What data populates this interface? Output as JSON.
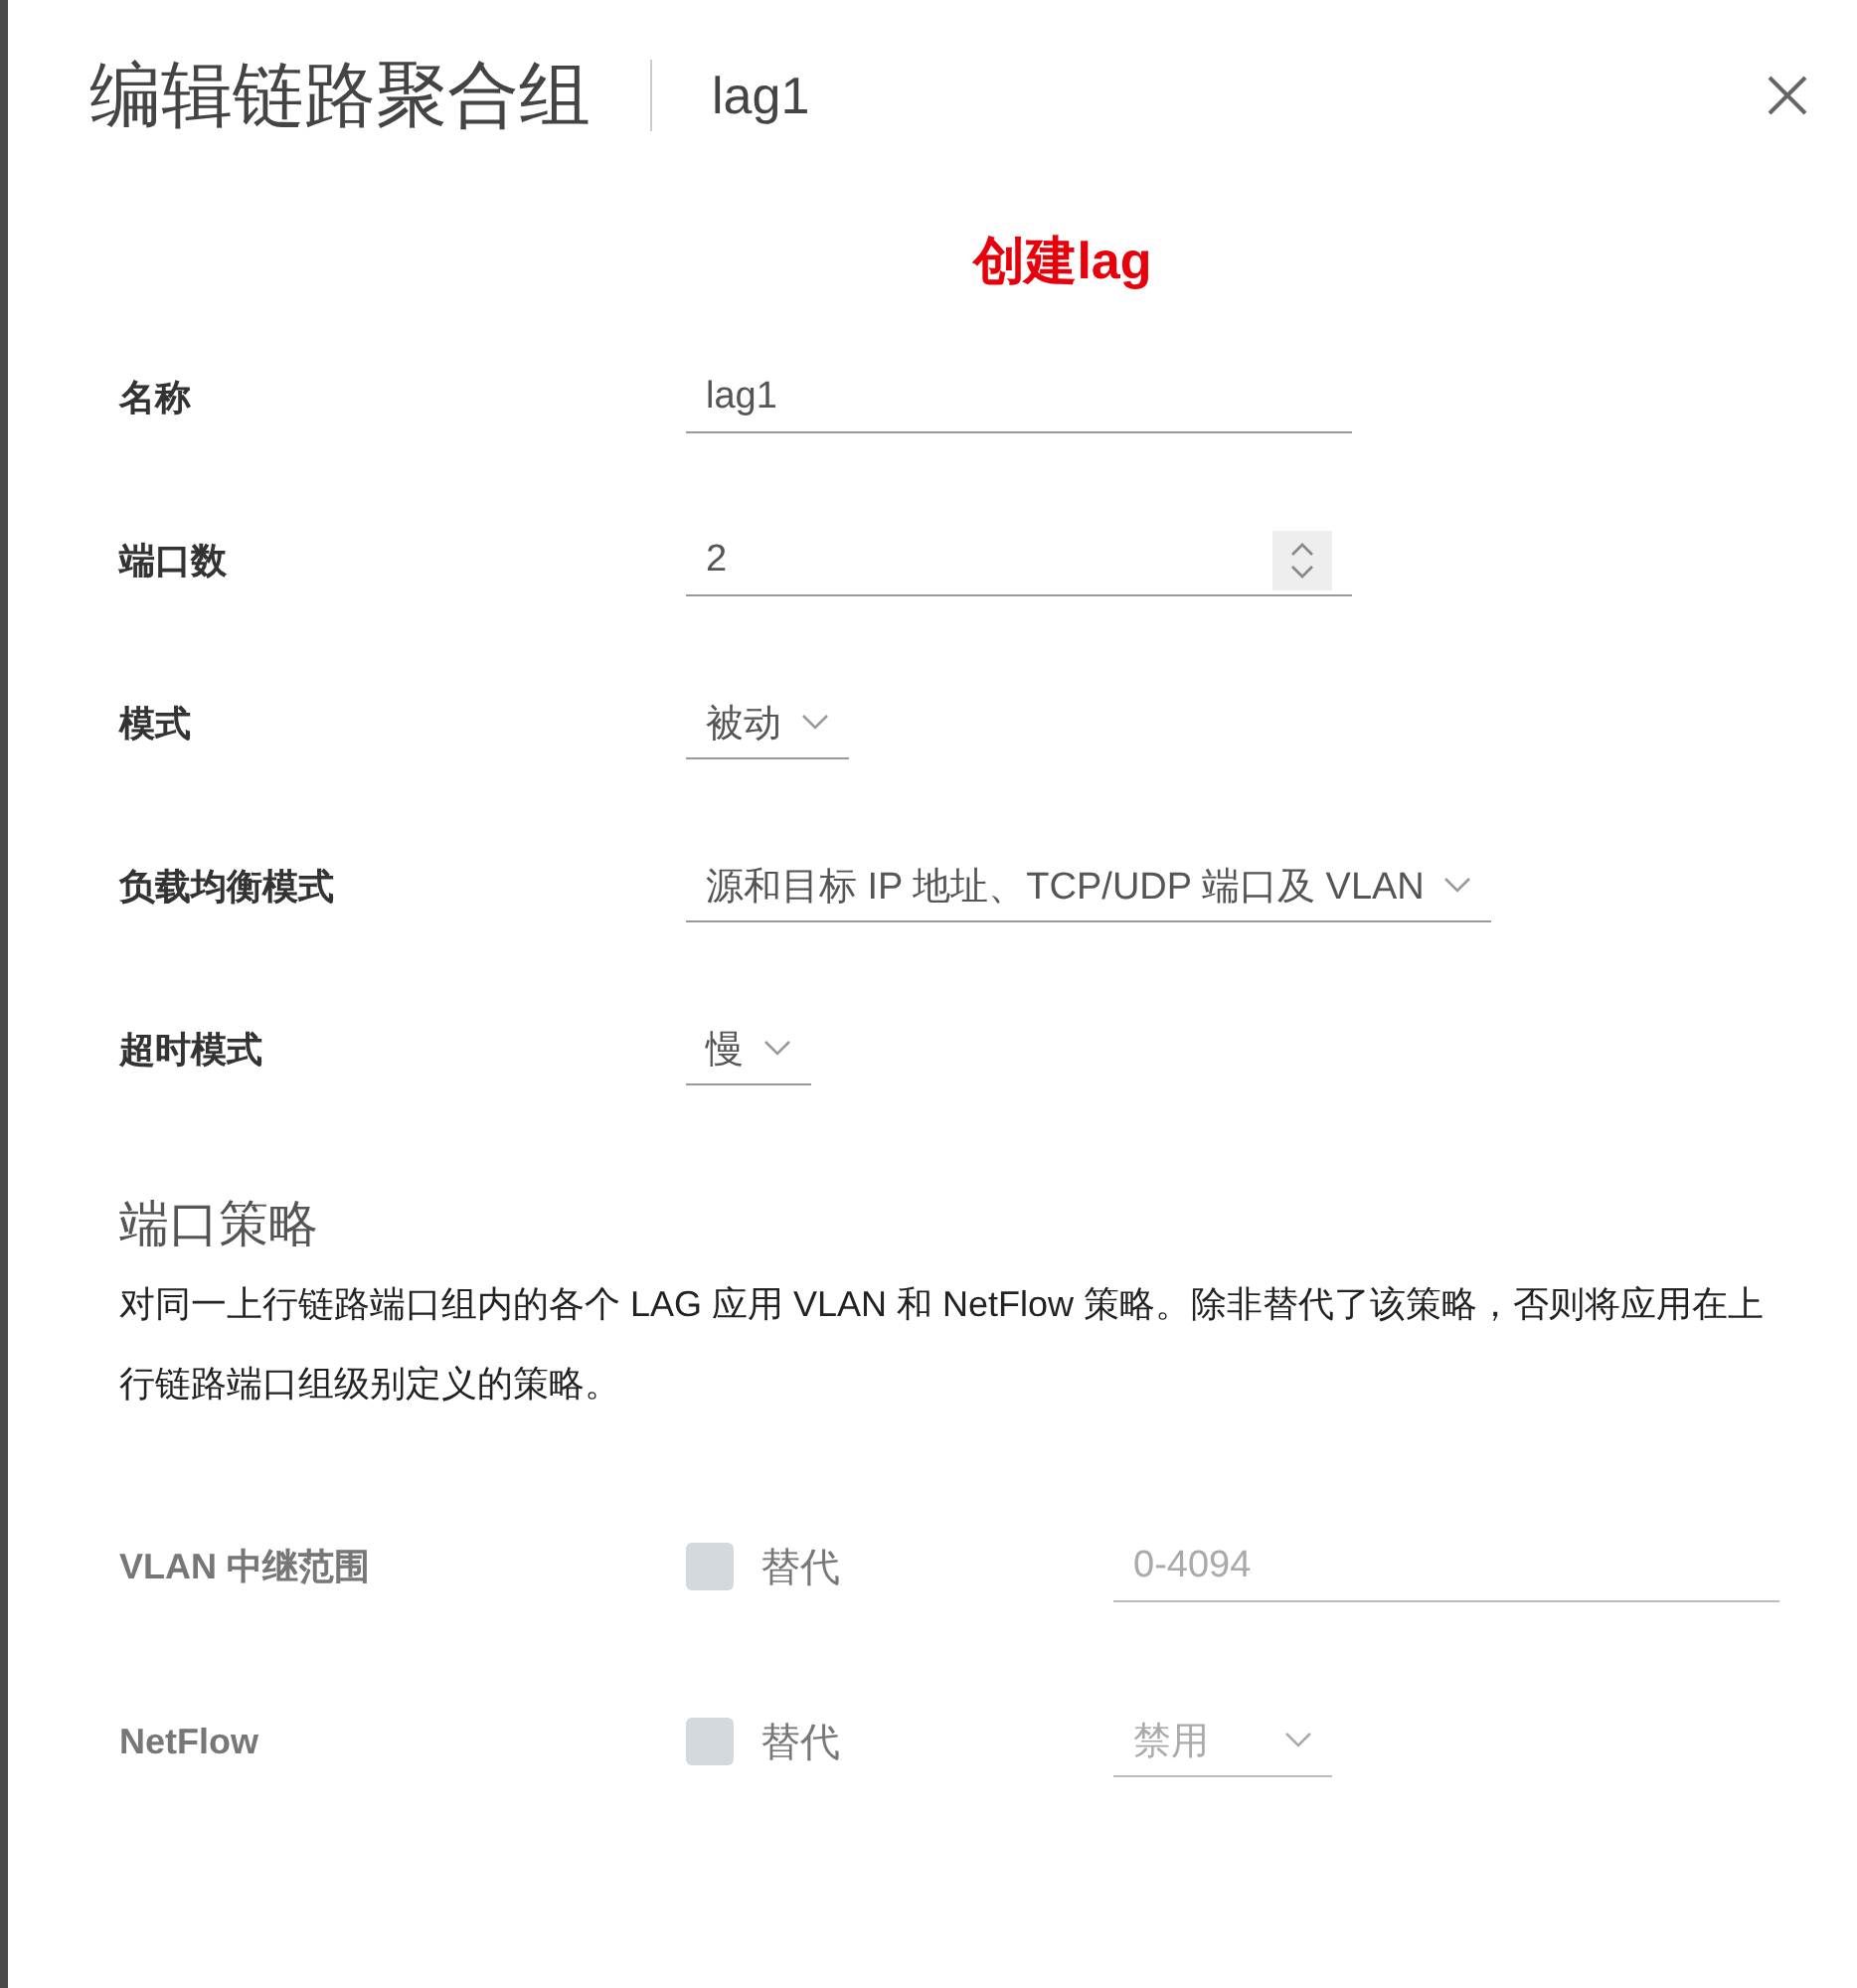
{
  "dialog": {
    "title": "编辑链路聚合组",
    "subtitle": "lag1"
  },
  "annotation": "创建lag",
  "fields": [
    {
      "label": "名称",
      "kind": "text",
      "value": "lag1"
    },
    {
      "label": "端口数",
      "kind": "number",
      "value": "2"
    },
    {
      "label": "模式",
      "kind": "select",
      "value": "被动"
    },
    {
      "label": "负载均衡模式",
      "kind": "select",
      "value": "源和目标 IP 地址、TCP/UDP 端口及 VLAN"
    },
    {
      "label": "超时模式",
      "kind": "select",
      "value": "慢"
    }
  ],
  "port_policy": {
    "heading": "端口策略",
    "description": "对同一上行链路端口组内的各个 LAG 应用 VLAN 和 NetFlow 策略。除非替代了该策略，否则将应用在上行链路端口组级别定义的策略。",
    "rows": [
      {
        "label": "VLAN 中继范围",
        "override_label": "替代",
        "checked": false,
        "disabled": true,
        "kind": "text",
        "value": "0-4094"
      },
      {
        "label": "NetFlow",
        "override_label": "替代",
        "checked": false,
        "disabled": true,
        "kind": "select",
        "value": "禁用"
      }
    ]
  }
}
